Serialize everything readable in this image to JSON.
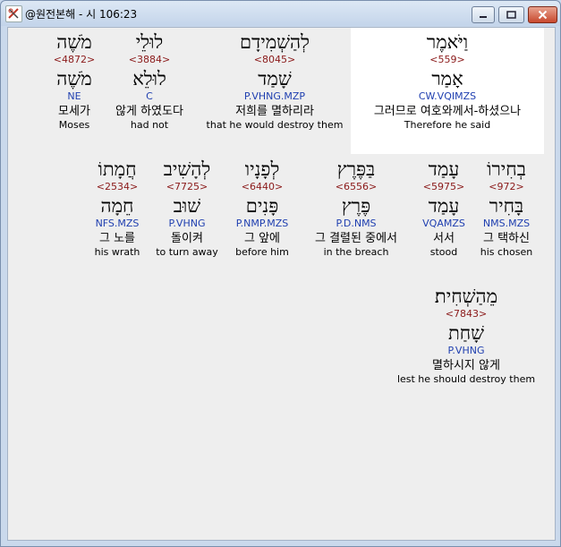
{
  "window": {
    "title": "@원전본해 - 시 106:23",
    "buttons": {
      "minimize": "minimize",
      "maximize": "maximize",
      "close": "close"
    }
  },
  "words": [
    {
      "heb": "וַיֹּאמֶר",
      "strong": "<559>",
      "lemma": "אָמַר",
      "morph": "CW.VQIMZS",
      "kor": "그러므로 여호와께서-하셨으나",
      "eng": "Therefore he said"
    },
    {
      "heb": "לְהַשְׁמִידָם",
      "strong": "<8045>",
      "lemma": "שָׁמַד",
      "morph": "P.VHNG.MZP",
      "kor": "저희를 멸하리라",
      "eng": "that he would destroy them"
    },
    {
      "heb": "לוּלֵי",
      "strong": "<3884>",
      "lemma": "לוּלֵא",
      "morph": "C",
      "kor": "않게 하였도다",
      "eng": "had not"
    },
    {
      "heb": "מֹשֶׁה",
      "strong": "<4872>",
      "lemma": "מֹשֶׁה",
      "morph": "NE",
      "kor": "모세가",
      "eng": "Moses"
    },
    {
      "heb": "בְחִירוֹ",
      "strong": "<972>",
      "lemma": "בָּחִיר",
      "morph": "NMS.MZS",
      "kor": "그 택하신",
      "eng": "his chosen"
    },
    {
      "heb": "עָמַד",
      "strong": "<5975>",
      "lemma": "עָמַד",
      "morph": "VQAMZS",
      "kor": "서서",
      "eng": "stood"
    },
    {
      "heb": "בַּפֶּרֶץ",
      "strong": "<6556>",
      "lemma": "פֶּרֶץ",
      "morph": "P.D.NMS",
      "kor": "그 결렬된 중에서",
      "eng": "in the breach"
    },
    {
      "heb": "לְפָנָיו",
      "strong": "<6440>",
      "lemma": "פָּנִים",
      "morph": "P.NMP.MZS",
      "kor": "그 앞에",
      "eng": "before him"
    },
    {
      "heb": "לְהָשִׁיב",
      "strong": "<7725>",
      "lemma": "שׁוּב",
      "morph": "P.VHNG",
      "kor": "돌이켜",
      "eng": "to turn away"
    },
    {
      "heb": "חֲמָתוֹ",
      "strong": "<2534>",
      "lemma": "חֵמָה",
      "morph": "NFS.MZS",
      "kor": "그 노를",
      "eng": "his wrath"
    },
    {
      "heb": "מֵהַשְׁחִית׃",
      "strong": "<7843>",
      "lemma": "שָׁחַת",
      "morph": "P.VHNG",
      "kor": "멸하시지 않게",
      "eng": "lest he should destroy them"
    }
  ],
  "colors": {
    "strong": "#8b1a1a",
    "morph": "#1f3fb0",
    "highlight": "#ffffff"
  }
}
